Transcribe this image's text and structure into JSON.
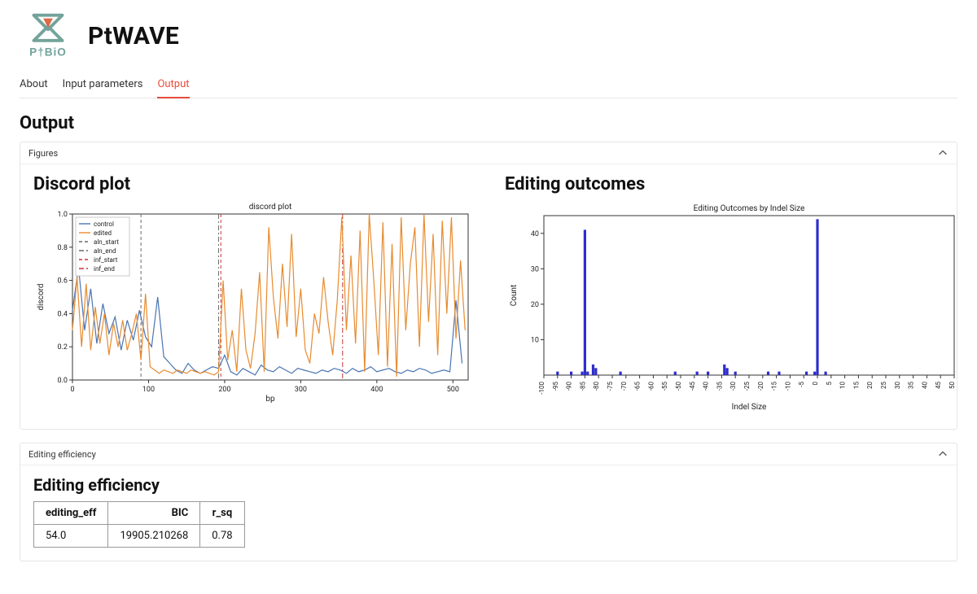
{
  "brand": {
    "name": "PtBiO",
    "app": "PtWAVE"
  },
  "tabs": [
    "About",
    "Input parameters",
    "Output"
  ],
  "active_tab": 2,
  "page_title": "Output",
  "panels": {
    "figures": {
      "label": "Figures"
    },
    "editing_eff": {
      "label": "Editing efficiency"
    }
  },
  "figures": {
    "discord": {
      "title": "Discord plot"
    },
    "outcomes": {
      "title": "Editing outcomes"
    }
  },
  "efficiency": {
    "title": "Editing efficiency",
    "columns": [
      "editing_eff",
      "BIC",
      "r_sq"
    ],
    "row": {
      "editing_eff": "54.0",
      "BIC": "19905.210268",
      "r_sq": "0.78"
    }
  },
  "chart_data": [
    {
      "id": "discord",
      "type": "line",
      "title": "discord plot",
      "xlabel": "bp",
      "ylabel": "discord",
      "xlim": [
        0,
        520
      ],
      "ylim": [
        0,
        1.0
      ],
      "yticks": [
        0.0,
        0.2,
        0.4,
        0.6,
        0.8,
        1.0
      ],
      "xticks": [
        0,
        100,
        200,
        300,
        400,
        500
      ],
      "vlines": {
        "aln_start": 90,
        "aln_end": 192,
        "inf_start": 195,
        "inf_end": 355
      },
      "series": [
        {
          "name": "control",
          "color": "#4a74b3",
          "x": [
            0,
            8,
            16,
            24,
            32,
            40,
            48,
            56,
            64,
            72,
            80,
            88,
            96,
            104,
            112,
            120,
            128,
            136,
            144,
            152,
            160,
            168,
            176,
            184,
            192,
            200,
            208,
            216,
            224,
            232,
            240,
            248,
            256,
            264,
            272,
            280,
            288,
            296,
            304,
            312,
            320,
            328,
            336,
            344,
            352,
            360,
            368,
            376,
            384,
            392,
            400,
            408,
            416,
            424,
            432,
            440,
            448,
            456,
            464,
            472,
            480,
            488,
            496,
            504,
            512
          ],
          "y": [
            0.42,
            0.68,
            0.3,
            0.55,
            0.22,
            0.46,
            0.28,
            0.38,
            0.18,
            0.36,
            0.24,
            0.42,
            0.26,
            0.2,
            0.5,
            0.14,
            0.1,
            0.06,
            0.04,
            0.1,
            0.06,
            0.04,
            0.06,
            0.08,
            0.07,
            0.15,
            0.05,
            0.03,
            0.07,
            0.05,
            0.03,
            0.09,
            0.06,
            0.05,
            0.08,
            0.06,
            0.04,
            0.07,
            0.06,
            0.05,
            0.04,
            0.06,
            0.05,
            0.07,
            0.06,
            0.04,
            0.07,
            0.05,
            0.06,
            0.08,
            0.05,
            0.06,
            0.07,
            0.05,
            0.04,
            0.06,
            0.05,
            0.07,
            0.06,
            0.04,
            0.05,
            0.06,
            0.05,
            0.48,
            0.1
          ]
        },
        {
          "name": "edited",
          "color": "#e78b2f",
          "x": [
            0,
            6,
            12,
            18,
            24,
            30,
            36,
            42,
            48,
            54,
            60,
            66,
            72,
            78,
            84,
            90,
            96,
            102,
            108,
            114,
            120,
            126,
            132,
            138,
            144,
            150,
            156,
            162,
            168,
            174,
            180,
            186,
            192,
            198,
            204,
            210,
            216,
            222,
            228,
            234,
            240,
            246,
            252,
            258,
            264,
            270,
            276,
            282,
            288,
            294,
            300,
            306,
            312,
            318,
            324,
            330,
            336,
            342,
            348,
            354,
            360,
            366,
            372,
            378,
            384,
            390,
            396,
            402,
            408,
            414,
            420,
            426,
            432,
            438,
            444,
            450,
            456,
            462,
            468,
            474,
            480,
            486,
            492,
            498,
            504,
            510,
            516
          ],
          "y": [
            0.3,
            0.62,
            0.2,
            0.58,
            0.18,
            0.44,
            0.22,
            0.4,
            0.15,
            0.34,
            0.2,
            0.36,
            0.18,
            0.28,
            0.4,
            0.12,
            0.52,
            0.08,
            0.06,
            0.04,
            0.06,
            0.05,
            0.04,
            0.06,
            0.05,
            0.04,
            0.06,
            0.05,
            0.04,
            0.05,
            0.04,
            0.03,
            0.05,
            0.6,
            0.12,
            0.3,
            0.05,
            0.55,
            0.18,
            0.07,
            0.28,
            0.65,
            0.05,
            0.92,
            0.5,
            0.25,
            0.7,
            0.32,
            0.88,
            0.26,
            0.55,
            0.18,
            0.1,
            0.4,
            0.28,
            0.62,
            0.35,
            0.15,
            0.48,
            0.98,
            0.3,
            0.75,
            0.22,
            0.9,
            0.05,
            1.0,
            0.6,
            0.15,
            0.95,
            0.08,
            0.82,
            0.02,
            0.98,
            0.3,
            0.7,
            0.92,
            0.2,
            1.0,
            0.35,
            0.88,
            0.15,
            0.96,
            0.4,
            0.98,
            0.25,
            0.72,
            0.3
          ]
        }
      ],
      "legend_labels": [
        "control",
        "edited",
        "aln_start",
        "aln_end",
        "inf_start",
        "inf_end"
      ]
    },
    {
      "id": "outcomes",
      "type": "bar",
      "title": "Editing Outcomes by Indel Size",
      "xlabel": "Indel Size",
      "ylabel": "Count",
      "xlim": [
        -100,
        50
      ],
      "ylim": [
        0,
        45
      ],
      "yticks": [
        10,
        20,
        30,
        40
      ],
      "xticks": [
        -100,
        -95,
        -90,
        -85,
        -80,
        -75,
        -70,
        -65,
        -60,
        -55,
        -50,
        -45,
        -40,
        -35,
        -30,
        -25,
        -20,
        -15,
        -10,
        -5,
        0,
        5,
        10,
        15,
        20,
        25,
        30,
        35,
        40,
        45,
        50
      ],
      "bars": [
        {
          "x": -95,
          "y": 1
        },
        {
          "x": -90,
          "y": 1
        },
        {
          "x": -86,
          "y": 1
        },
        {
          "x": -85,
          "y": 41
        },
        {
          "x": -84,
          "y": 1
        },
        {
          "x": -82,
          "y": 3
        },
        {
          "x": -81,
          "y": 2
        },
        {
          "x": -72,
          "y": 1
        },
        {
          "x": -52,
          "y": 1
        },
        {
          "x": -44,
          "y": 1
        },
        {
          "x": -40,
          "y": 1
        },
        {
          "x": -34,
          "y": 3
        },
        {
          "x": -33,
          "y": 2
        },
        {
          "x": -30,
          "y": 1
        },
        {
          "x": -18,
          "y": 1
        },
        {
          "x": -14,
          "y": 1
        },
        {
          "x": -4,
          "y": 1
        },
        {
          "x": -1,
          "y": 1
        },
        {
          "x": 0,
          "y": 44
        },
        {
          "x": 3,
          "y": 1
        }
      ],
      "bar_color": "#2e2ecb"
    }
  ]
}
